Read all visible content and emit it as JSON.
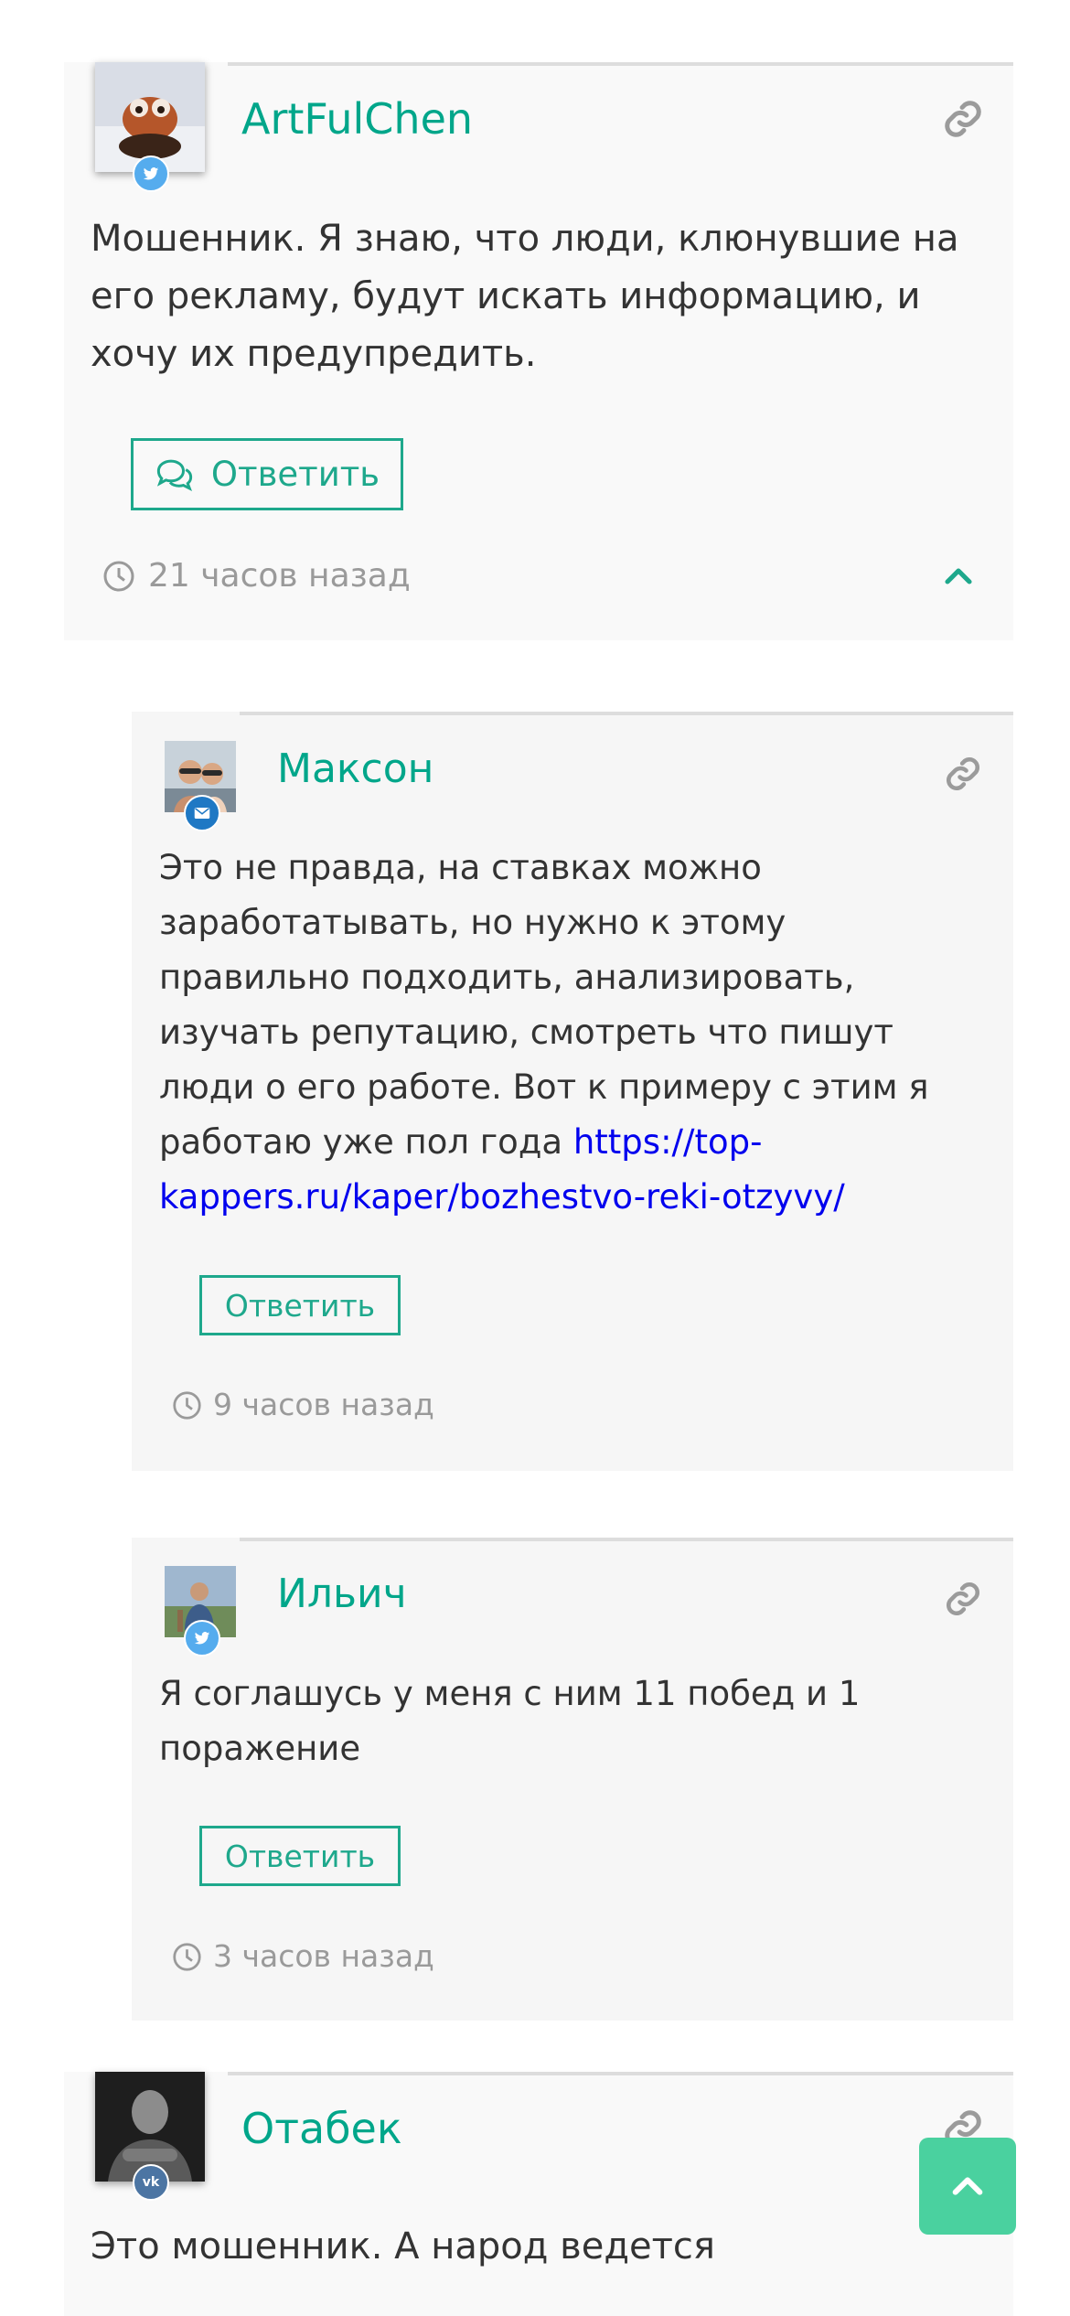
{
  "comments": [
    {
      "author": "ArtFulChen",
      "network": "twitter",
      "text": "Мошенник. Я знаю, что люди, клюнувшие на его рекламу, будут искать информацию, и хочу их предупредить.",
      "reply_label": "Ответить",
      "time": "21 часов назад"
    },
    {
      "author": "Максон",
      "network": "email",
      "text": "Это не правда, на ставках можно заработатывать, но нужно к этому правильно подходить, анализировать, изучать репутацию, смотреть что пишут люди о его работе. Вот к примеру с этим я работаю уже пол года ",
      "link": "https://top-kappers.ru/kaper/bozhestvo-reki-otzyvy/",
      "reply_label": "Ответить",
      "time": "9 часов назад"
    },
    {
      "author": "Ильич",
      "network": "twitter",
      "text": "Я соглашусь у меня с ним 11 побед и 1 поражение",
      "reply_label": "Ответить",
      "time": "3 часов назад"
    },
    {
      "author": "Отабек",
      "network": "vk",
      "text": "Это мошенник. А народ ведется"
    }
  ],
  "colors": {
    "accent": "#00a68a",
    "link": "#0000ee",
    "twitter": "#55acee",
    "email": "#1f78c4",
    "vk": "#4c75a3",
    "scroll_button": "#4ad19f"
  },
  "icons": {
    "permalink": "link-icon",
    "reply": "chat-bubbles-icon",
    "time": "clock-icon",
    "collapse": "chevron-up-icon",
    "scroll_top": "chevron-up-icon"
  }
}
